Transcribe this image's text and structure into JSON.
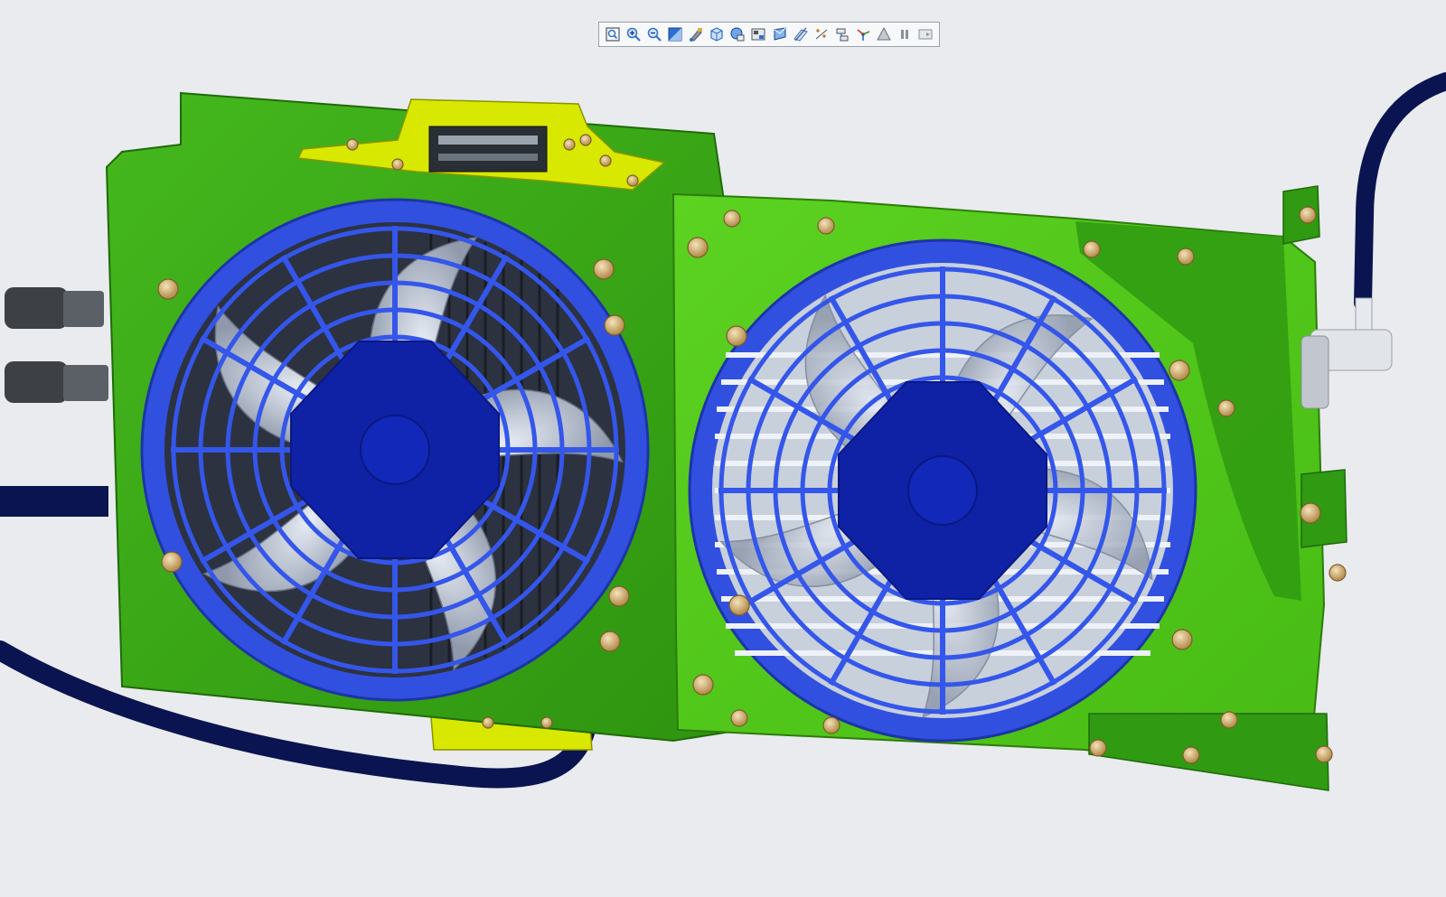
{
  "toolbar": {
    "buttons": [
      {
        "name": "zoom-fit-icon"
      },
      {
        "name": "zoom-in-icon"
      },
      {
        "name": "zoom-out-icon"
      },
      {
        "name": "view-orientation-icon"
      },
      {
        "name": "repaint-icon"
      },
      {
        "name": "saved-views-icon"
      },
      {
        "name": "display-style-icon"
      },
      {
        "name": "view-manager-icon"
      },
      {
        "name": "section-icon"
      },
      {
        "name": "datum-display-icon"
      },
      {
        "name": "datum-points-icon"
      },
      {
        "name": "annotation-icon"
      },
      {
        "name": "spin-center-icon"
      },
      {
        "name": "appearance-icon"
      },
      {
        "name": "pause-icon"
      },
      {
        "name": "more-options-icon"
      }
    ]
  },
  "colors": {
    "background": "#e9ebee",
    "frame_green": "#3aa817",
    "frame_dark_green": "#2b8a0e",
    "bracket_yellow": "#d8e800",
    "fan_blue": "#3150e0",
    "hub_blue": "#0f22a6",
    "hose_navy": "#0a1450",
    "bolt_gold": "#cfa968"
  }
}
